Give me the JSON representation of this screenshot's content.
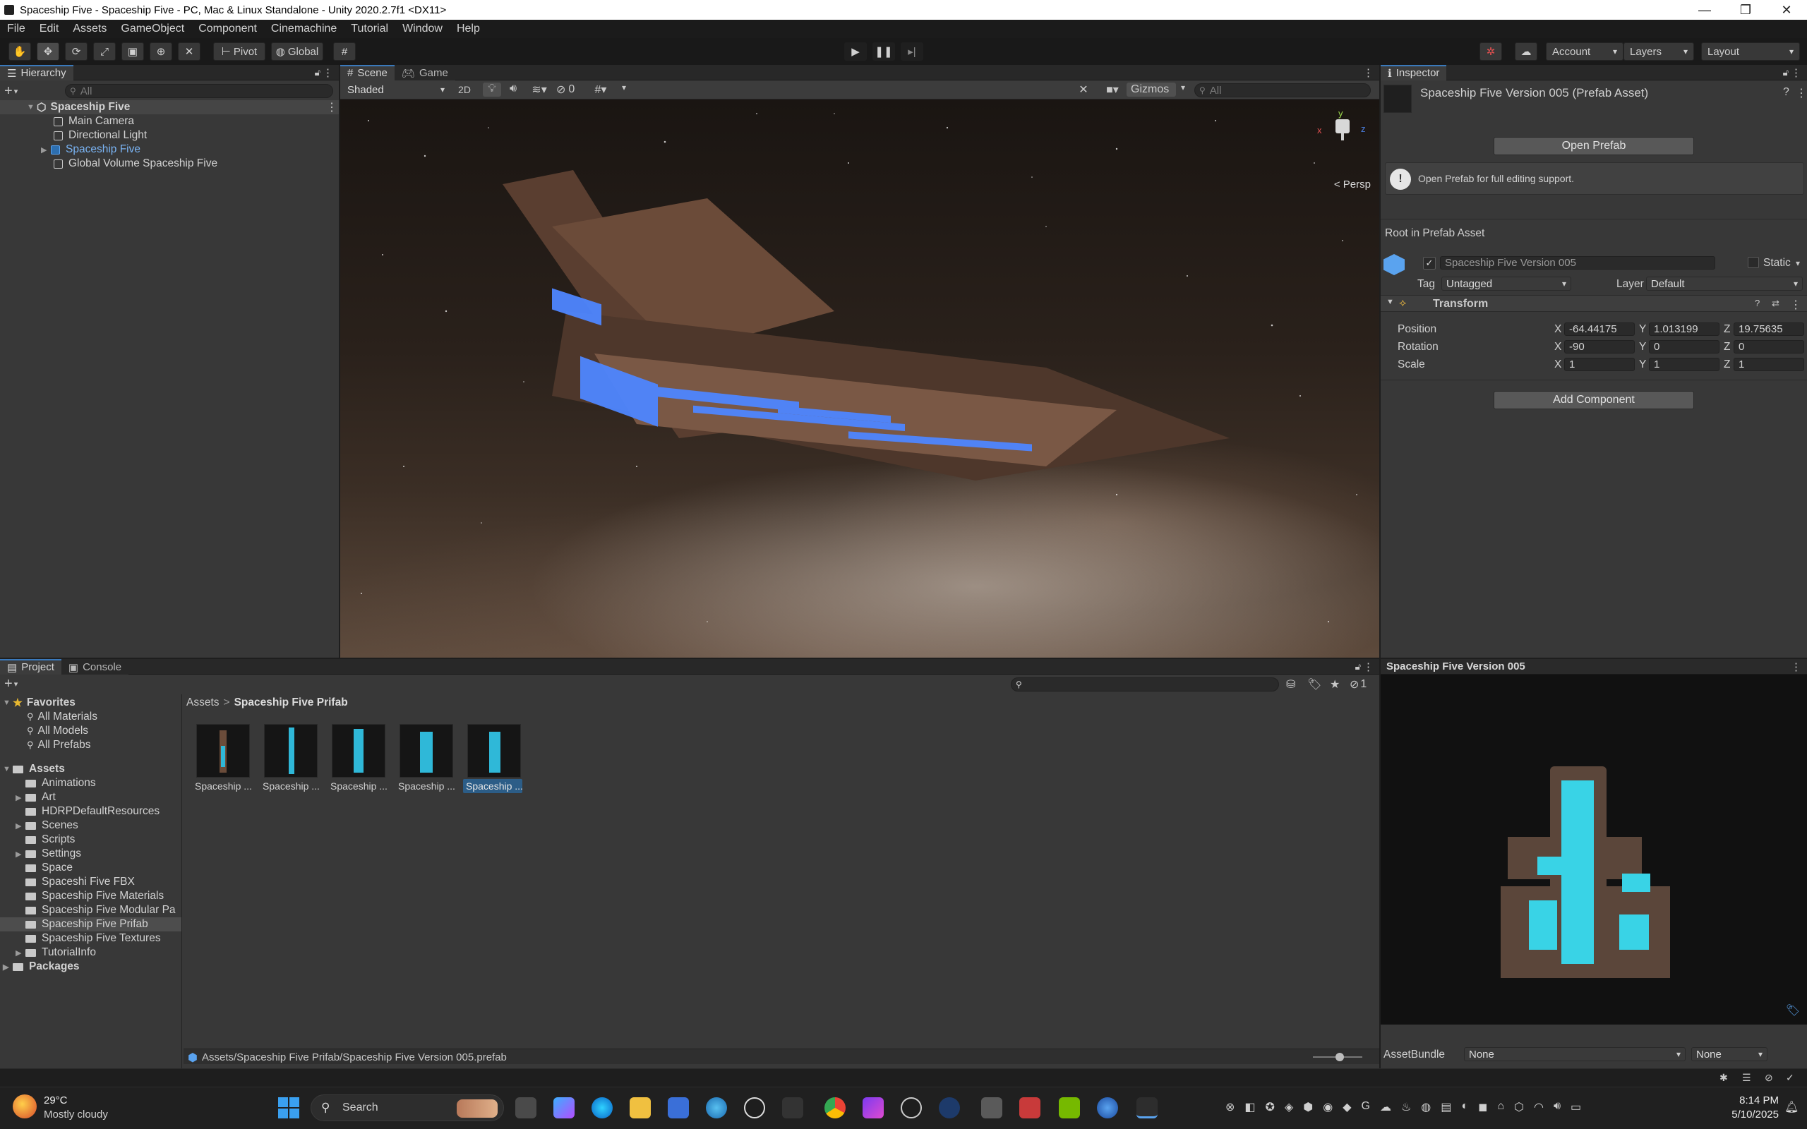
{
  "window": {
    "title": "Spaceship Five - Spaceship Five - PC, Mac & Linux Standalone - Unity 2020.2.7f1 <DX11>"
  },
  "menu": [
    "File",
    "Edit",
    "Assets",
    "GameObject",
    "Component",
    "Cinemachine",
    "Tutorial",
    "Window",
    "Help"
  ],
  "toolbar": {
    "pivot": "Pivot",
    "global": "Global",
    "account": "Account",
    "layers": "Layers",
    "layout": "Layout"
  },
  "hierarchy": {
    "tab": "Hierarchy",
    "search_placeholder": "All",
    "scene": "Spaceship Five",
    "items": [
      "Main Camera",
      "Directional Light",
      "Spaceship Five",
      "Global Volume Spaceship Five"
    ]
  },
  "scene": {
    "tabs": [
      "Scene",
      "Game"
    ],
    "shading": "Shaded",
    "mode2d": "2D",
    "hidden_count": "0",
    "gizmos": "Gizmos",
    "search_placeholder": "All",
    "persp": "< Persp",
    "axes": {
      "x": "x",
      "y": "y",
      "z": "z"
    }
  },
  "inspector": {
    "tab": "Inspector",
    "title": "Spaceship Five Version 005 (Prefab Asset)",
    "open_prefab": "Open Prefab",
    "info": "Open Prefab for full editing support.",
    "root_label": "Root in Prefab Asset",
    "object_name": "Spaceship Five Version 005",
    "static": "Static",
    "tag_label": "Tag",
    "tag_value": "Untagged",
    "layer_label": "Layer",
    "layer_value": "Default",
    "transform": "Transform",
    "position": {
      "label": "Position",
      "x": "-64.44175",
      "y": "1.013199",
      "z": "19.75635"
    },
    "rotation": {
      "label": "Rotation",
      "x": "-90",
      "y": "0",
      "z": "0"
    },
    "scale": {
      "label": "Scale",
      "x": "1",
      "y": "1",
      "z": "1"
    },
    "add_component": "Add Component",
    "axis_labels": {
      "x": "X",
      "y": "Y",
      "z": "Z"
    }
  },
  "preview": {
    "title": "Spaceship Five Version 005",
    "assetbundle_label": "AssetBundle",
    "assetbundle_value": "None",
    "variant_value": "None"
  },
  "project": {
    "tabs": [
      "Project",
      "Console"
    ],
    "favorites": "Favorites",
    "fav_items": [
      "All Materials",
      "All Models",
      "All Prefabs"
    ],
    "assets": "Assets",
    "folders": [
      "Animations",
      "Art",
      "HDRPDefaultResources",
      "Scenes",
      "Scripts",
      "Settings",
      "Space",
      "Spaceshi Five FBX",
      "Spaceship Five Materials",
      "Spaceship Five Modular Pa",
      "Spaceship Five Prifab",
      "Spaceship Five Textures",
      "TutorialInfo"
    ],
    "packages": "Packages",
    "breadcrumb": [
      "Assets",
      "Spaceship Five Prifab"
    ],
    "breadcrumb_sep": ">",
    "thumbs": [
      "Spaceship ...",
      "Spaceship ...",
      "Spaceship ...",
      "Spaceship ...",
      "Spaceship ..."
    ],
    "hidden_count": "1",
    "status_path": "Assets/Spaceship Five Prifab/Spaceship Five Version 005.prefab"
  },
  "taskbar": {
    "weather_temp": "29°C",
    "weather_desc": "Mostly cloudy",
    "search": "Search",
    "time": "8:14 PM",
    "date": "5/10/2025"
  },
  "colors": {
    "accent": "#3a79bb",
    "selected": "#2c5d87",
    "panel": "#383838"
  }
}
